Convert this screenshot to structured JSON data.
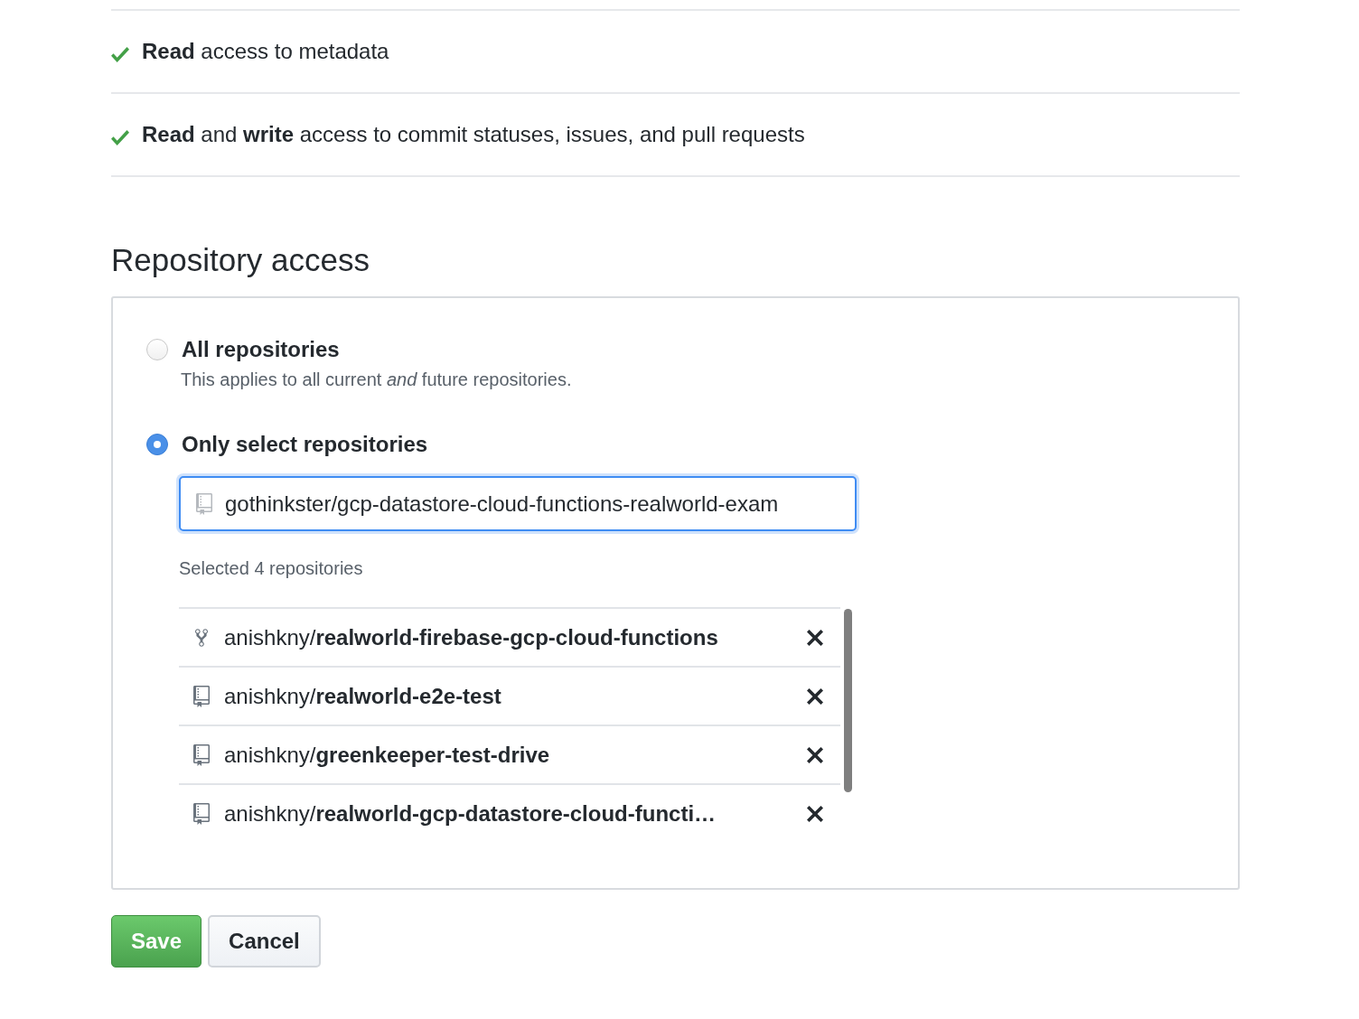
{
  "permissions": [
    {
      "text": "**Read** access to metadata"
    },
    {
      "text": "**Read** and **write** access to commit statuses, issues, and pull requests"
    }
  ],
  "repository_access": {
    "title": "Repository access",
    "options": [
      {
        "label": "All repositories",
        "description": "This applies to all current *and* future repositories.",
        "selected": false
      },
      {
        "label": "Only select repositories",
        "selected": true
      }
    ],
    "search": {
      "value": "gothinkster/gcp-datastore-cloud-functions-realworld-exam"
    },
    "selected_count": "Selected 4 repositories",
    "repositories": [
      {
        "kind": "fork",
        "text": "anishkny/**realworld-firebase-gcp-cloud-functions**"
      },
      {
        "kind": "repo",
        "text": "anishkny/**realworld-e2e-test**"
      },
      {
        "kind": "repo",
        "text": "anishkny/**greenkeeper-test-drive**"
      },
      {
        "kind": "repo",
        "text": "anishkny/**realworld-gcp-datastore-cloud-functi…**"
      }
    ]
  },
  "buttons": [
    {
      "label": "Save",
      "kind": "primary"
    },
    {
      "label": "Cancel",
      "kind": "secondary"
    }
  ]
}
